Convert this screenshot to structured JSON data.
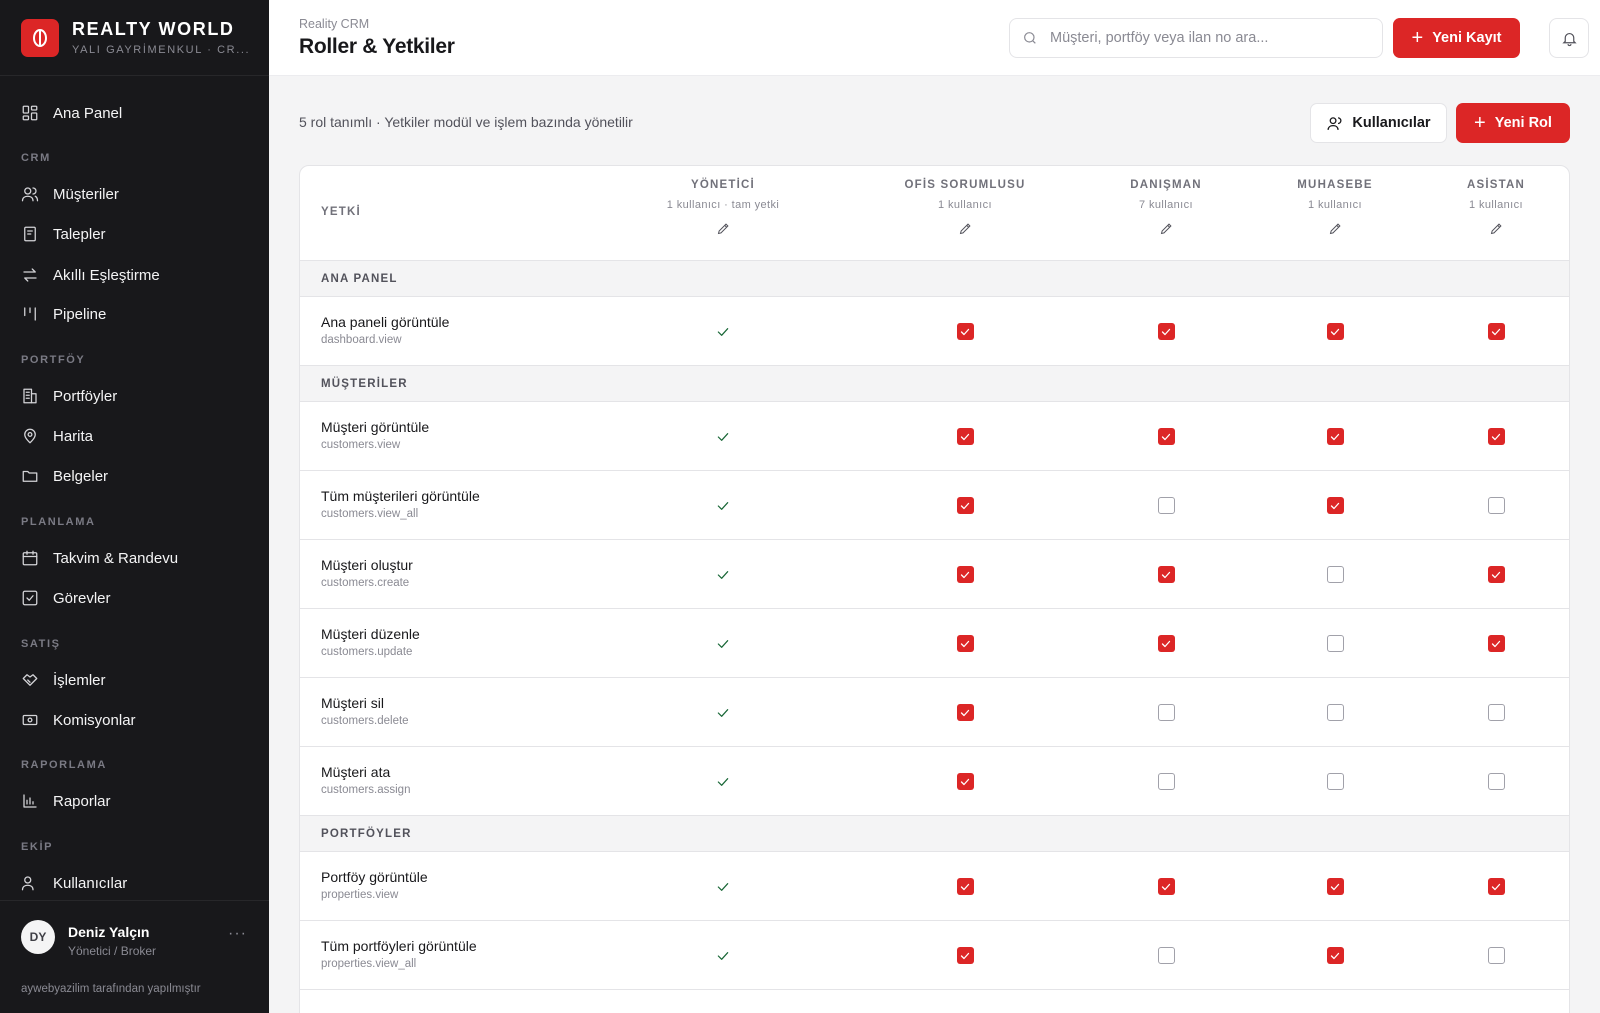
{
  "brand": {
    "name": "REALTY WORLD",
    "subtitle": "YALI GAYRİMENKUL · CR..."
  },
  "nav": {
    "top": {
      "label": "Ana Panel",
      "icon": "dashboard-icon"
    },
    "sections": [
      {
        "title": "CRM",
        "items": [
          {
            "label": "Müşteriler",
            "icon": "users-icon"
          },
          {
            "label": "Talepler",
            "icon": "bookmark-icon"
          },
          {
            "label": "Akıllı Eşleştirme",
            "icon": "arrows-exchange-icon"
          },
          {
            "label": "Pipeline",
            "icon": "pipeline-icon"
          }
        ]
      },
      {
        "title": "PORTFÖY",
        "items": [
          {
            "label": "Portföyler",
            "icon": "building-icon"
          },
          {
            "label": "Harita",
            "icon": "map-pin-icon"
          },
          {
            "label": "Belgeler",
            "icon": "folder-icon"
          }
        ]
      },
      {
        "title": "PLANLAMA",
        "items": [
          {
            "label": "Takvim & Randevu",
            "icon": "calendar-icon"
          },
          {
            "label": "Görevler",
            "icon": "checkbox-icon"
          }
        ]
      },
      {
        "title": "SATIŞ",
        "items": [
          {
            "label": "İşlemler",
            "icon": "handshake-icon"
          },
          {
            "label": "Komisyonlar",
            "icon": "money-icon"
          }
        ]
      },
      {
        "title": "RAPORLAMA",
        "items": [
          {
            "label": "Raporlar",
            "icon": "bar-chart-icon"
          }
        ]
      },
      {
        "title": "EKİP",
        "items": [
          {
            "label": "Kullanıcılar",
            "icon": "users-icon"
          }
        ]
      }
    ]
  },
  "user": {
    "initials": "DY",
    "name": "Deniz Yalçın",
    "role": "Yönetici / Broker",
    "more": "···",
    "credit": "aywebyazilim tarafından yapılmıştır"
  },
  "header": {
    "breadcrumb": "Reality CRM",
    "title": "Roller & Yetkiler",
    "search_placeholder": "Müşteri, portföy veya ilan no ara...",
    "new_record": "Yeni Kayıt"
  },
  "toolbar": {
    "summary": "5 rol tanımlı · Yetkiler modül ve işlem bazında yönetilir",
    "users_button": "Kullanıcılar",
    "new_role_button": "Yeni Rol"
  },
  "matrix": {
    "perm_header": "YETKİ",
    "roles": [
      {
        "name": "YÖNETİCİ",
        "count": "1 kullanıcı · tam yetki"
      },
      {
        "name": "OFİS SORUMLUSU",
        "count": "1 kullanıcı"
      },
      {
        "name": "DANIŞMAN",
        "count": "7 kullanıcı"
      },
      {
        "name": "MUHASEBE",
        "count": "1 kullanıcı"
      },
      {
        "name": "ASİSTAN",
        "count": "1 kullanıcı"
      }
    ],
    "groups": [
      {
        "title": "ANA PANEL",
        "rows": [
          {
            "label": "Ana paneli görüntüle",
            "key": "dashboard.view",
            "values": [
              true,
              true,
              true,
              true
            ]
          }
        ]
      },
      {
        "title": "MÜŞTERİLER",
        "rows": [
          {
            "label": "Müşteri görüntüle",
            "key": "customers.view",
            "values": [
              true,
              true,
              true,
              true
            ]
          },
          {
            "label": "Tüm müşterileri görüntüle",
            "key": "customers.view_all",
            "values": [
              true,
              false,
              true,
              false
            ]
          },
          {
            "label": "Müşteri oluştur",
            "key": "customers.create",
            "values": [
              true,
              true,
              false,
              true
            ]
          },
          {
            "label": "Müşteri düzenle",
            "key": "customers.update",
            "values": [
              true,
              true,
              false,
              true
            ]
          },
          {
            "label": "Müşteri sil",
            "key": "customers.delete",
            "values": [
              true,
              false,
              false,
              false
            ]
          },
          {
            "label": "Müşteri ata",
            "key": "customers.assign",
            "values": [
              true,
              false,
              false,
              false
            ]
          }
        ]
      },
      {
        "title": "PORTFÖYLER",
        "rows": [
          {
            "label": "Portföy görüntüle",
            "key": "properties.view",
            "values": [
              true,
              true,
              true,
              true
            ]
          },
          {
            "label": "Tüm portföyleri görüntüle",
            "key": "properties.view_all",
            "values": [
              true,
              false,
              true,
              false
            ]
          }
        ]
      }
    ]
  },
  "colors": {
    "accent": "#dc2626",
    "sidebar": "#18181b",
    "admin_tick": "#166534"
  }
}
